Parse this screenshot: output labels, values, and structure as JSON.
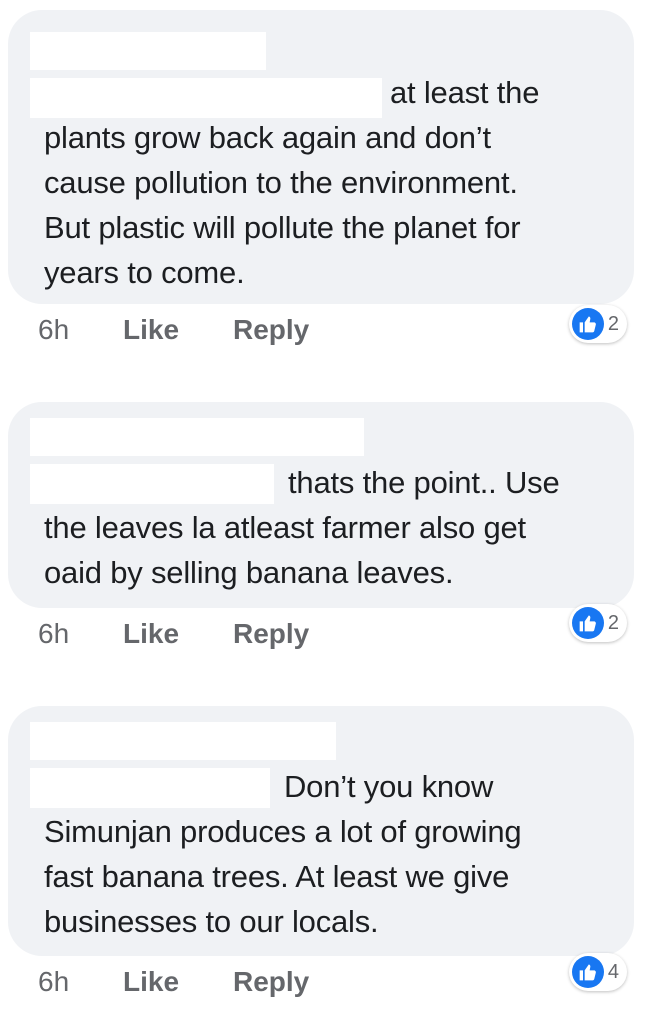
{
  "comments": [
    {
      "lines": [
        "at least the",
        "plants grow back again and don’t",
        "cause pollution to the environment.",
        "But plastic will pollute the planet for",
        "years to come."
      ],
      "time": "6h",
      "like_label": "Like",
      "reply_label": "Reply",
      "reaction_count": "2"
    },
    {
      "lines": [
        "thats the point.. Use",
        "the leaves la atleast farmer also get",
        "oaid by selling banana leaves."
      ],
      "time": "6h",
      "like_label": "Like",
      "reply_label": "Reply",
      "reaction_count": "2"
    },
    {
      "lines": [
        "Don’t you know",
        "Simunjan produces a lot of growing",
        "fast banana trees. At least we give",
        "businesses to our locals."
      ],
      "time": "6h",
      "like_label": "Like",
      "reply_label": "Reply",
      "reaction_count": "4"
    }
  ],
  "reaction_icon": "thumbs-up-icon",
  "colors": {
    "bubble": "#f0f2f5",
    "text": "#1c1e21",
    "meta": "#65676b",
    "like_blue": "#1877f2"
  }
}
